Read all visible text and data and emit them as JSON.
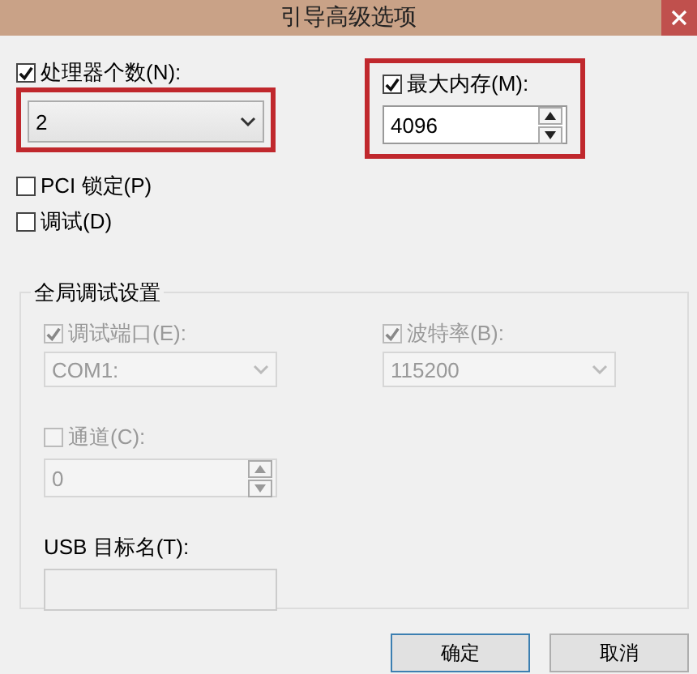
{
  "window": {
    "title": "引导高级选项"
  },
  "processors": {
    "label": "处理器个数(N):",
    "checked": true,
    "value": "2",
    "highlighted": true
  },
  "max_memory": {
    "label": "最大内存(M):",
    "checked": true,
    "value": "4096",
    "highlighted": true
  },
  "options": [
    {
      "label": "PCI 锁定(P)",
      "checked": false
    },
    {
      "label": "调试(D)",
      "checked": false
    }
  ],
  "debug_group": {
    "title": "全局调试设置",
    "debug_port": {
      "label": "调试端口(E):",
      "checked": true,
      "disabled": true,
      "value": "COM1:"
    },
    "baud_rate": {
      "label": "波特率(B):",
      "checked": true,
      "disabled": true,
      "value": "115200"
    },
    "channel": {
      "label": "通道(C):",
      "checked": false,
      "disabled": true,
      "value": "0"
    },
    "usb_target": {
      "label": "USB 目标名(T):",
      "disabled": true
    }
  },
  "buttons": [
    "确定",
    "取消"
  ]
}
